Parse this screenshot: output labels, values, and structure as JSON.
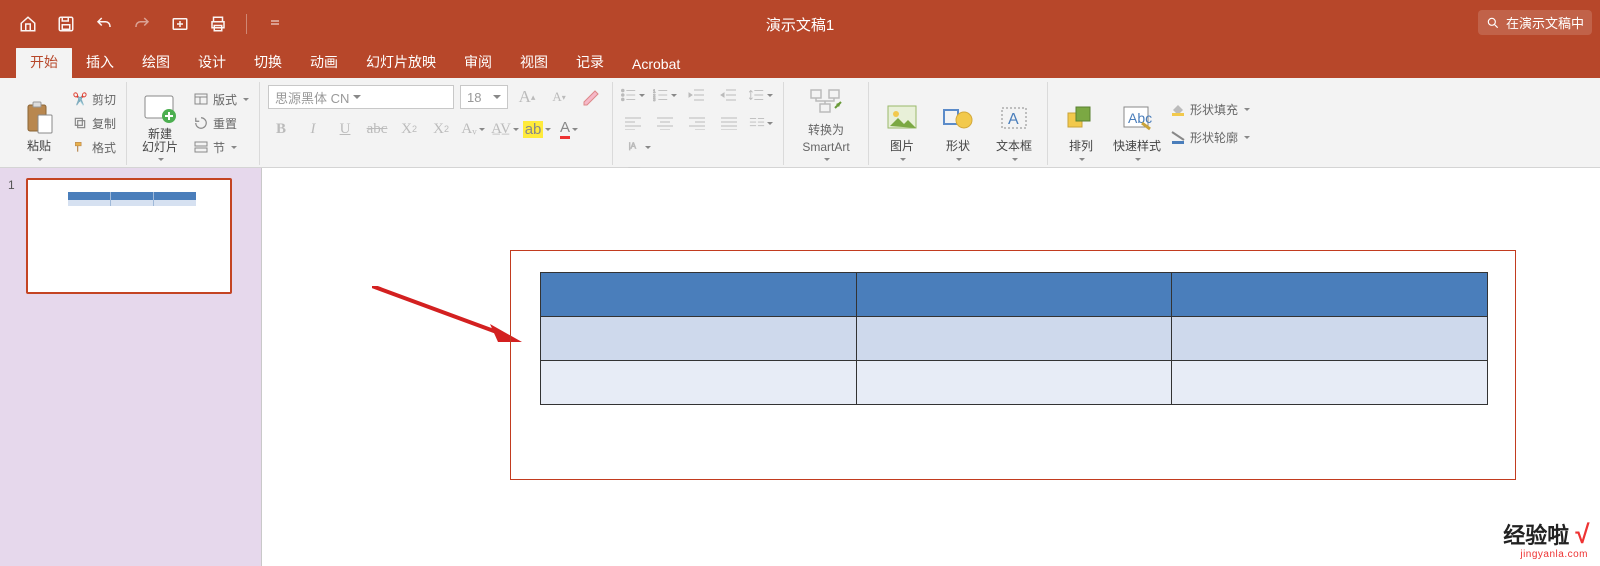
{
  "titlebar": {
    "document_title": "演示文稿1",
    "search_placeholder": "在演示文稿中"
  },
  "tabs": {
    "items": [
      "开始",
      "插入",
      "绘图",
      "设计",
      "切换",
      "动画",
      "幻灯片放映",
      "审阅",
      "视图",
      "记录",
      "Acrobat"
    ],
    "active_index": 0
  },
  "ribbon": {
    "clipboard": {
      "paste": "粘贴",
      "cut": "剪切",
      "copy": "复制",
      "format_painter": "格式"
    },
    "slides": {
      "new_slide": "新建\n幻灯片",
      "layout": "版式",
      "reset": "重置",
      "section": "节"
    },
    "font": {
      "name": "思源黑体 CN",
      "size": "18"
    },
    "smartart": {
      "convert_label": "转换为",
      "smartart_label": "SmartArt"
    },
    "insert": {
      "picture": "图片",
      "shapes": "形状",
      "textbox": "文本框"
    },
    "arrange": {
      "arrange": "排列",
      "quick_styles": "快速样式",
      "shape_fill": "形状填充",
      "shape_outline": "形状轮廓"
    }
  },
  "thumbs": {
    "slide1_number": "1"
  },
  "watermark": {
    "brand": "经验啦",
    "url": "jingyanla.com"
  }
}
